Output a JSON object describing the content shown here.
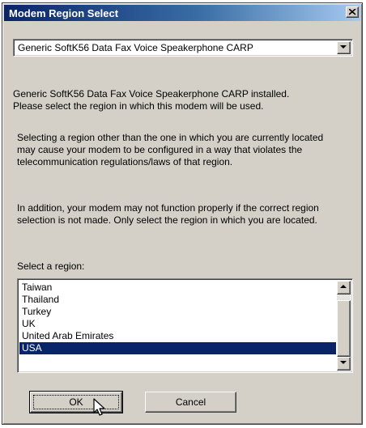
{
  "window": {
    "title": "Modem Region Select"
  },
  "modem_select": {
    "value": "Generic SoftK56 Data Fax Voice Speakerphone CARP"
  },
  "messages": {
    "installed_line1": "Generic SoftK56 Data Fax Voice Speakerphone CARP installed.",
    "installed_line2": "Please select the region in which this modem will be used.",
    "warning_line1": "Selecting a region other than the one in which you are currently located",
    "warning_line2": "may cause your modem to be configured in a way that violates the",
    "warning_line3": "telecommunication regulations/laws of that region.",
    "addition_line1": "In addition, your modem may not function properly if the correct region",
    "addition_line2": "selection is not made. Only select the region in which you are located.",
    "select_label": "Select a region:"
  },
  "region_list": {
    "items": [
      "Taiwan",
      "Thailand",
      "Turkey",
      "UK",
      "United Arab Emirates",
      "USA"
    ],
    "selected": "USA"
  },
  "buttons": {
    "ok": "OK",
    "cancel": "Cancel"
  },
  "icons": {
    "close": "close-icon",
    "dropdown": "chevron-down-icon",
    "scroll_up": "arrow-up-icon",
    "scroll_down": "arrow-down-icon",
    "cursor": "mouse-pointer-icon"
  },
  "colors": {
    "title_start": "#0a246a",
    "title_end": "#a6caf0",
    "selection": "#0a246a",
    "face": "#d4d0c8"
  }
}
